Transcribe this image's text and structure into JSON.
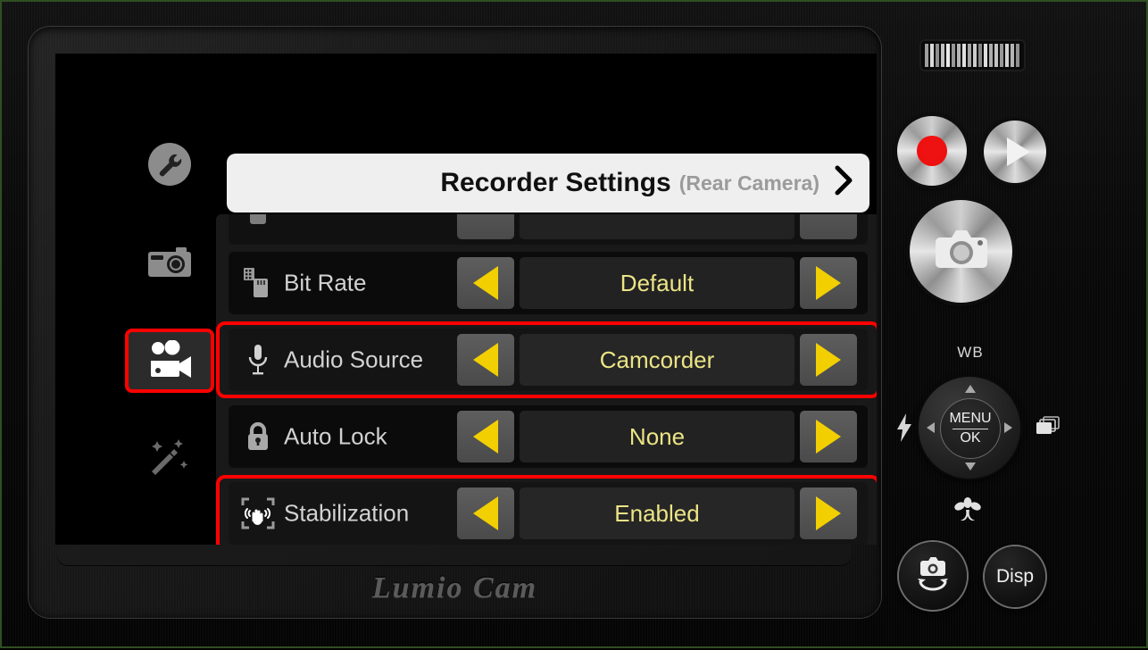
{
  "device": {
    "brand": "Lumio Cam",
    "grille_name": "speaker-grille"
  },
  "header": {
    "title": "Recorder Settings",
    "subtitle": "(Rear Camera)",
    "chevron": "chevron-right-icon"
  },
  "sidebar": {
    "items": [
      {
        "id": "tools",
        "icon": "wrench-icon",
        "label": "Tools",
        "selected": false
      },
      {
        "id": "photo",
        "icon": "camera-icon",
        "label": "Photo",
        "selected": false
      },
      {
        "id": "video",
        "icon": "camcorder-icon",
        "label": "Video",
        "selected": true
      },
      {
        "id": "effects",
        "icon": "magic-wand-icon",
        "label": "Effects",
        "selected": false
      }
    ]
  },
  "settings": {
    "prev_label": "Previous value",
    "next_label": "Next value",
    "rows": [
      {
        "icon": "sd-card-icon",
        "label": "Bit Rate",
        "value": "Default",
        "highlighted": false
      },
      {
        "icon": "microphone-icon",
        "label": "Audio Source",
        "value": "Camcorder",
        "highlighted": true
      },
      {
        "icon": "lock-icon",
        "label": "Auto Lock",
        "value": "None",
        "highlighted": false
      },
      {
        "icon": "stabilization-icon",
        "label": "Stabilization",
        "value": "Enabled",
        "highlighted": true
      }
    ]
  },
  "controls": {
    "record": "record-button",
    "play": "play-button",
    "shutter": "shutter-button",
    "wb_label": "WB",
    "dpad_menu": "MENU",
    "dpad_ok": "OK",
    "flash": "flash-icon",
    "burst": "burst-mode-icon",
    "macro": "macro-icon",
    "switch_camera": "switch-camera-button",
    "disp_label": "Disp"
  },
  "colors": {
    "accent_yellow": "#f2cf00",
    "value_text": "#ece486",
    "highlight_red": "#ff0000",
    "record_red": "#ee1212",
    "header_bg": "#efefef",
    "subtitle_gray": "#9b9b9b"
  }
}
